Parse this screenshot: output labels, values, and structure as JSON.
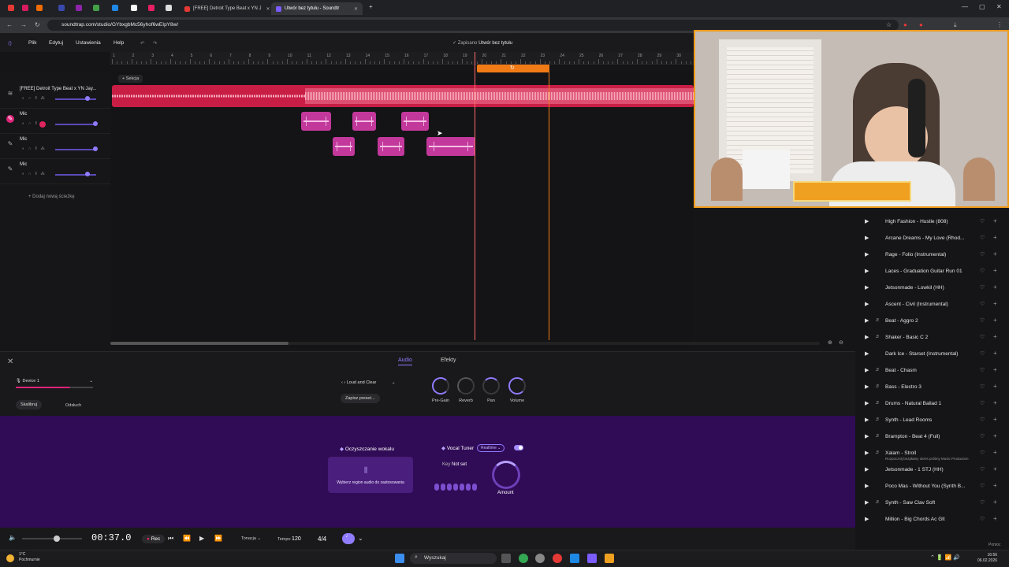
{
  "browser": {
    "tabs": [
      {
        "label": "[FREE] Detroit Type Beat x YN J",
        "active": false
      },
      {
        "label": "Utwór bez tytułu - Soundtr",
        "active": true
      }
    ],
    "url": "soundtrap.com/studio/GYbxgbMc56yhof6wEIpY8w/"
  },
  "app": {
    "menu": [
      "Plik",
      "Edytuj",
      "Ustawienia",
      "Help"
    ],
    "saved_label": "Zapisano",
    "project_title": "Utwór bez tytułu"
  },
  "ruler": {
    "numbers": [
      "1",
      "2",
      "3",
      "4",
      "5",
      "6",
      "7",
      "8",
      "9",
      "10",
      "11",
      "12",
      "13",
      "14",
      "15",
      "16",
      "17",
      "18",
      "19",
      "20",
      "21",
      "22",
      "23",
      "24",
      "25",
      "26",
      "27",
      "28",
      "29",
      "30"
    ]
  },
  "timeline": {
    "section_button": "+ Sekcja",
    "tracks": [
      {
        "name": "[FREE] Detroit Type Beat x YN Jay...",
        "icon": "waveform-icon",
        "active": false
      },
      {
        "name": "Mic",
        "icon": "pencil-icon",
        "active": true
      },
      {
        "name": "Mic",
        "icon": "pencil-icon",
        "active": false
      },
      {
        "name": "Mic",
        "icon": "pencil-icon",
        "active": false
      }
    ],
    "add_track": "+ Dodaj nową ścieżkę"
  },
  "panel": {
    "tab_audio": "Audio",
    "tab_effects": "Efekty",
    "device": "Device 1",
    "calibrate": "Skalibruj",
    "monitor": "Odsłuch",
    "preset": "Loud and Clear",
    "save_preset": "Zapisz preset...",
    "knobs": [
      "Pre-Gain",
      "Reverb",
      "Pan",
      "Volume"
    ]
  },
  "effects": {
    "clean_title": "Oczyszczanie wokalu",
    "clean_hint": "Wybierz region audio do zastosowania",
    "tuner_title": "Vocal Tuner",
    "tuner_mode": "Realtime",
    "key_label": "Key",
    "key_value": "Not set",
    "amount_label": "Amount"
  },
  "transport": {
    "time": "00:37.0",
    "rec": "Rec",
    "key_label": "Tonacja",
    "tempo_label": "Tempo",
    "tempo": "120",
    "time_signature": "4/4"
  },
  "library": {
    "items": [
      {
        "title": "High Fashion - Hustle (808)",
        "icon": "play-icon"
      },
      {
        "title": "Arcane Dreams - My Love (Rhod...",
        "icon": "play-icon"
      },
      {
        "title": "Rage - Folio (Instrumental)",
        "icon": "play-icon"
      },
      {
        "title": "Laces - Graduation Guitar Run 01",
        "icon": "play-icon"
      },
      {
        "title": "Jetsonmade - Lowkil (HH)",
        "icon": "play-icon"
      },
      {
        "title": "Ascent - Civil (Instrumental)",
        "icon": "play-icon"
      },
      {
        "title": "Beat - Aggro 2",
        "icon": "note-icon"
      },
      {
        "title": "Shaker - Basic C 2",
        "icon": "note-icon"
      },
      {
        "title": "Dark Ice - Starset (Instrumental)",
        "icon": "play-icon"
      },
      {
        "title": "Beat - Chasm",
        "icon": "note-icon"
      },
      {
        "title": "Bass - Electro 3",
        "icon": "note-icon"
      },
      {
        "title": "Drums - Natural Ballad 1",
        "icon": "note-icon"
      },
      {
        "title": "Synth - Lead Rooms",
        "icon": "note-icon"
      },
      {
        "title": "Brampton - Beat 4 (Full)",
        "icon": "note-icon"
      },
      {
        "title": "Xalam - Stroll",
        "icon": "note-icon",
        "sub": "Rozpocznij bezpłatny okres próbny Music Production"
      },
      {
        "title": "Jetsonmade - 1 STJ (HH)",
        "icon": "play-icon"
      },
      {
        "title": "Poco Mas - Without You (Synth B...",
        "icon": "play-icon"
      },
      {
        "title": "Synth - Saw Clav Soft",
        "icon": "note-icon"
      },
      {
        "title": "Million - Big Chords Ac Glt",
        "icon": "play-icon"
      }
    ],
    "help": "Pomoc"
  },
  "taskbar": {
    "temperature": "1°C",
    "weather": "Pochmurnie",
    "search": "Wyszukaj",
    "time": "16:56",
    "date": "06.02.2026"
  }
}
